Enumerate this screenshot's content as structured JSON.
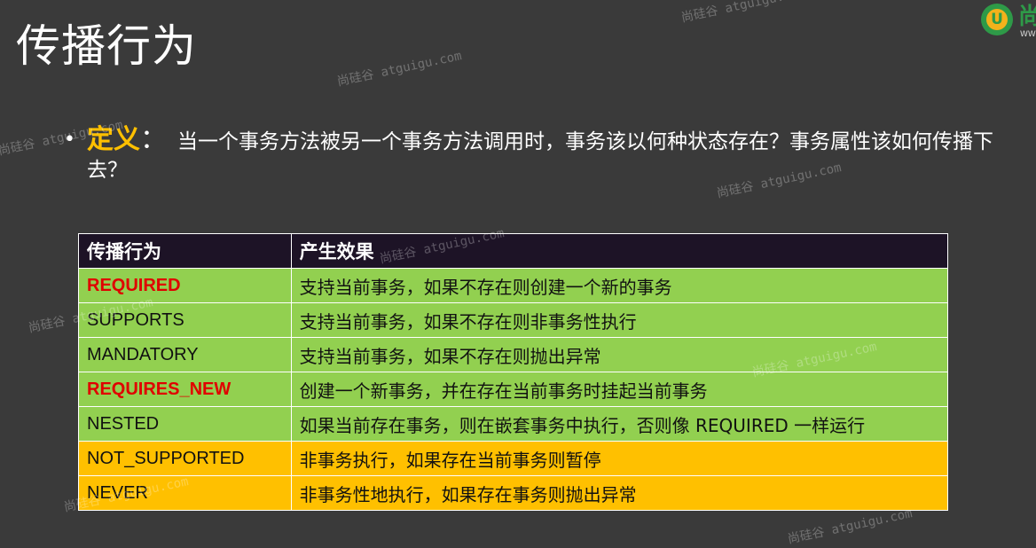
{
  "slide": {
    "title": "传播行为",
    "logo": {
      "mark": "U",
      "brand_char": "尚",
      "brand_sub": "WWW"
    },
    "definition": {
      "bullet": "•",
      "term": "定义",
      "colon": "：",
      "text": "当一个事务方法被另一个事务方法调用时，事务该以何种状态存在？事务属性该如何传播下去？"
    },
    "table": {
      "headers": [
        "传播行为",
        "产生效果"
      ],
      "rows": [
        {
          "name": "REQUIRED",
          "effect": "支持当前事务，如果不存在则创建一个新的事务"
        },
        {
          "name": "SUPPORTS",
          "effect": "支持当前事务，如果不存在则非事务性执行"
        },
        {
          "name": "MANDATORY",
          "effect": "支持当前事务，如果不存在则抛出异常"
        },
        {
          "name": "REQUIRES_NEW",
          "effect": "创建一个新事务，并在存在当前事务时挂起当前事务"
        },
        {
          "name": "NESTED",
          "effect": "如果当前存在事务，则在嵌套事务中执行，否则像 REQUIRED 一样运行"
        },
        {
          "name": "NOT_SUPPORTED",
          "effect": "非事务执行，如果存在当前事务则暂停"
        },
        {
          "name": "NEVER",
          "effect": "非事务性地执行，如果存在事务则抛出异常"
        }
      ]
    },
    "watermarks": [
      "尚硅谷 atguigu.com",
      "尚硅谷 atguigu.com",
      "尚硅谷 atguigu.com",
      "尚硅谷 atguigu.com",
      "尚硅谷 atguigu.com",
      "尚硅谷 atguigu.com",
      "尚硅谷 atguigu.com",
      "尚硅谷 atguigu.com",
      "尚硅谷 atguigu.com"
    ],
    "colors": {
      "background": "#3a3a3a",
      "accent": "#ffc000",
      "header": "#1d1326",
      "row_green": "#92d050",
      "row_orange": "#ffc000",
      "highlight_red": "#e00000"
    }
  }
}
